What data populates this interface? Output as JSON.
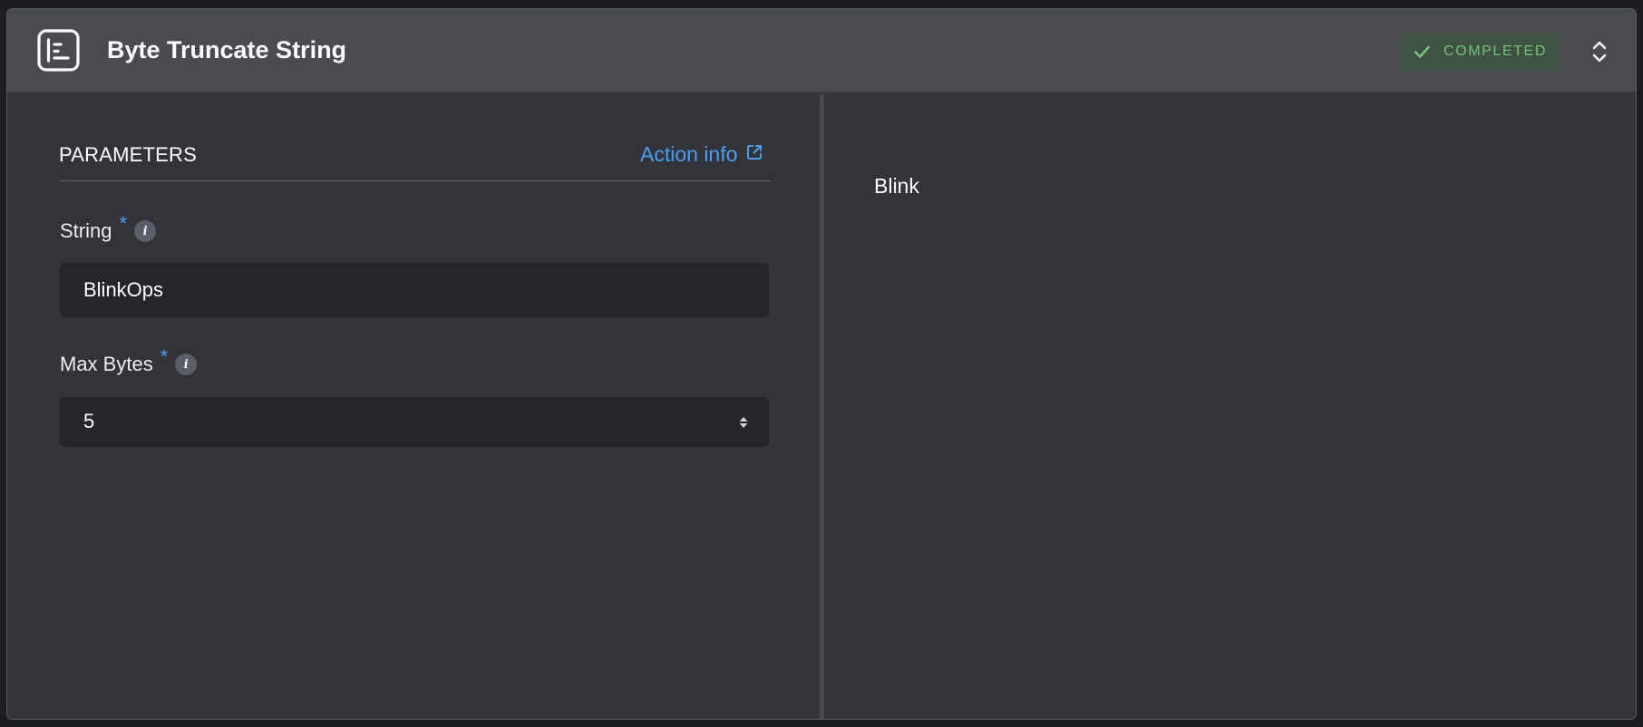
{
  "header": {
    "title": "Byte Truncate String",
    "status": "COMPLETED",
    "step_icon": "step-list-icon",
    "status_icon": "check-icon",
    "toggle_icon": "expand-collapse-icon"
  },
  "parameters": {
    "heading": "PARAMETERS",
    "action_info_label": "Action info",
    "action_info_icon": "external-link-icon",
    "fields": [
      {
        "label": "String",
        "required_mark": "*",
        "info_icon": "info-icon",
        "value": "BlinkOps"
      },
      {
        "label": "Max Bytes",
        "required_mark": "*",
        "info_icon": "info-icon",
        "value": "5"
      }
    ]
  },
  "output": {
    "text": "Blink"
  },
  "colors": {
    "accent": "#4b9ff0",
    "status_green": "#72c37c",
    "status_bg": "#3f5243",
    "header_bg": "#4a4b51",
    "body_bg": "#33343a",
    "input_bg": "#25262b"
  }
}
